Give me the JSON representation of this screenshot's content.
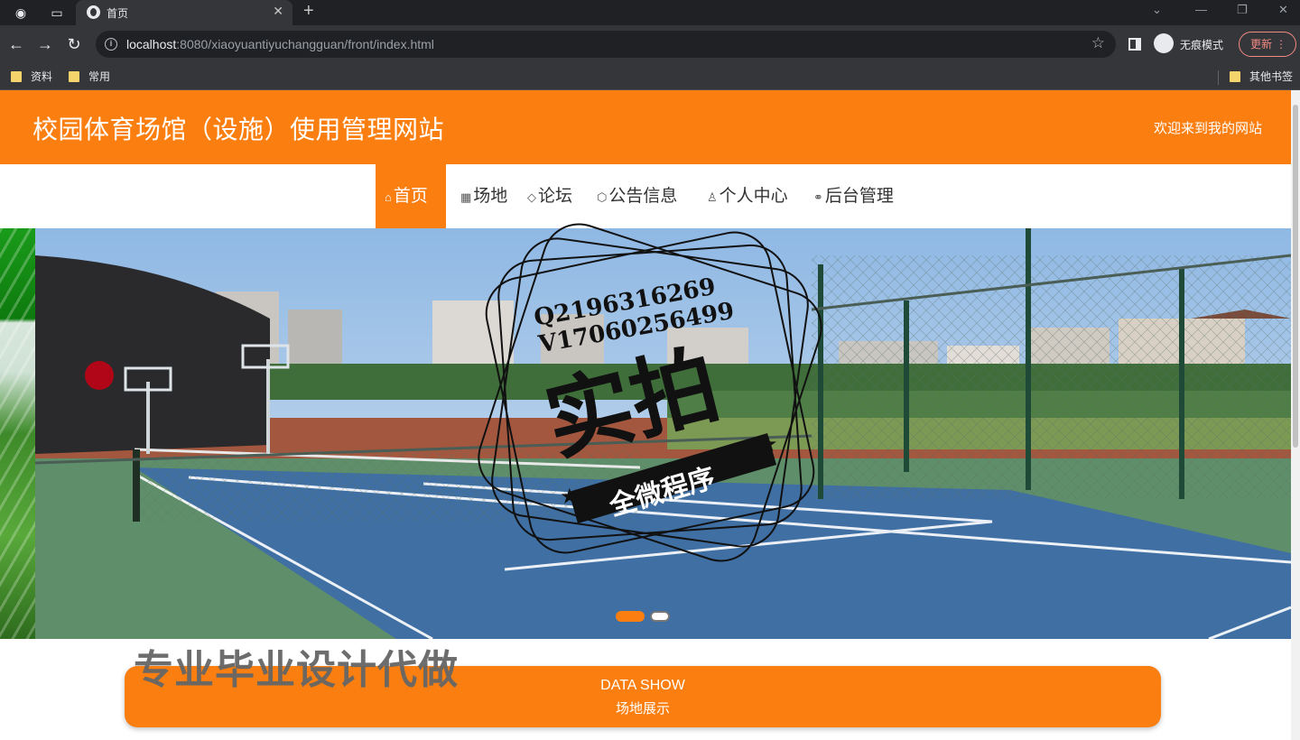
{
  "browser": {
    "tab_title": "首页",
    "url_host": "localhost",
    "url_rest": ":8080/xiaoyuantiyuchangguan/front/index.html",
    "incognito_label": "无痕模式",
    "update_label": "更新",
    "bookmarks": [
      "资料",
      "常用"
    ],
    "other_bookmarks": "其他书签"
  },
  "site": {
    "title": "校园体育场馆（设施）使用管理网站",
    "welcome": "欢迎来到我的网站",
    "nav": [
      {
        "label": "首页",
        "icon": "home-icon"
      },
      {
        "label": "场地",
        "icon": "grid-icon"
      },
      {
        "label": "论坛",
        "icon": "tag-icon"
      },
      {
        "label": "公告信息",
        "icon": "box-icon"
      },
      {
        "label": "个人中心",
        "icon": "user-icon"
      },
      {
        "label": "后台管理",
        "icon": "link-icon"
      }
    ],
    "active_nav_index": 0,
    "banner": {
      "slide_count": 2,
      "active_slide": 0
    },
    "data_show": {
      "title_en": "DATA SHOW",
      "title_zh": "场地展示"
    }
  },
  "overlay": {
    "stamp_line1": "Q2196316269",
    "stamp_line2": "V17060256499",
    "stamp_big": "实拍",
    "stamp_ribbon": "全微程序",
    "promo_text": "专业毕业设计代做"
  },
  "colors": {
    "accent": "#fb7f10",
    "chrome_dark": "#202124",
    "chrome": "#35363a"
  }
}
